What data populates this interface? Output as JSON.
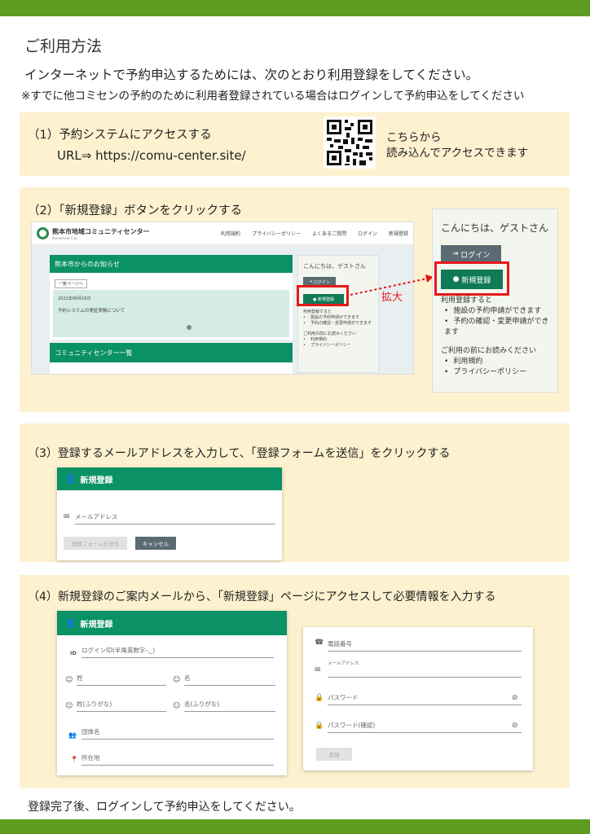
{
  "page": {
    "title": "ご利用方法",
    "intro_main": "インターネットで予約申込するためには、次のとおり利用登録をしてください。",
    "intro_note": "※すでに他コミセンの予約のために利用者登録されている場合はログインして予約申込をしてください",
    "footer": "登録完了後、ログインして予約申込をしてください。"
  },
  "step1": {
    "title": "（1）予約システムにアクセスする",
    "url": "URL⇒ https://comu-center.site/",
    "qr_line1": "こちらから",
    "qr_line2": "読み込んでアクセスできます"
  },
  "step2": {
    "title": "（2）「新規登録」ボタンをクリックする",
    "site_name": "熊本市地域コミュニティセンター",
    "site_sub": "Kumamoto City",
    "nav": [
      "利用規約",
      "プライバシーポリシー",
      "よくあるご質問",
      "ログイン",
      "新規登録"
    ],
    "news_header": "熊本市からのお知らせ",
    "list_button": "一覧ページへ",
    "news_date": "2022年06月16日",
    "news_text": "予約システムの実証実験について",
    "centers_header": "コミュニティセンター一覧",
    "greeting": "こんにちは、ゲストさん",
    "login": "ログイン",
    "register": "新規登録",
    "after_register": "利用登録すると",
    "benefits": [
      "施設の予約申請ができます",
      "予約の確認・変更申請ができます"
    ],
    "read_before": "ご利用の前にお読みください",
    "links": [
      "利用規約",
      "プライバシーポリシー"
    ],
    "zoom_label": "拡大"
  },
  "step3": {
    "title": "（3）登録するメールアドレスを入力して、「登録フォームを送信」をクリックする",
    "form_title": "新規登録",
    "email_placeholder": "メールアドレス",
    "submit": "登録フォームを送信",
    "cancel": "キャンセル"
  },
  "step4": {
    "title": "（4）新規登録のご案内メールから、「新規登録」ページにアクセスして必要情報を入力する",
    "form_title": "新規登録",
    "id_prefix": "ID",
    "login_id": "ログインID(半角英数字-,_)",
    "last_name": "姓",
    "first_name": "名",
    "last_kana": "姓(ふりがな)",
    "first_kana": "名(ふりがな)",
    "group": "団体名",
    "address": "所在地",
    "phone": "電話番号",
    "email": "メールアドレス",
    "password": "パスワード",
    "password_confirm": "パスワード(確認)",
    "register_btn": "登録"
  },
  "colors": {
    "bar": "#5c9c1f",
    "panel": "#fdf1cf",
    "green": "#0a9166",
    "red": "#e61919"
  }
}
